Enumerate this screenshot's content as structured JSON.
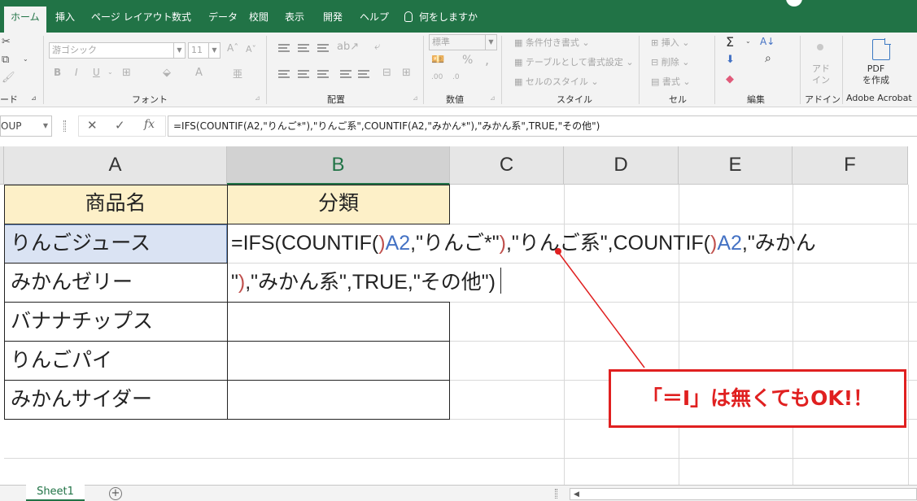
{
  "ribbon_tabs": [
    "ホーム",
    "挿入",
    "ページ レイアウト",
    "数式",
    "データ",
    "校閲",
    "表示",
    "開発",
    "ヘルプ"
  ],
  "tell_me": "何をしますか",
  "ribbon": {
    "clipboard_label": "ード",
    "font_label": "フォント",
    "font_name": "游ゴシック",
    "font_size": "11",
    "alignment_label": "配置",
    "number_label": "数値",
    "number_format": "標準",
    "styles_label": "スタイル",
    "styles_items": [
      "条件付き書式",
      "テーブルとして書式設定",
      "セルのスタイル"
    ],
    "cells_label": "セル",
    "cells_items": [
      "挿入",
      "削除",
      "書式"
    ],
    "editing_label": "編集",
    "addin_label": "アドイン",
    "addin_button": [
      "アド",
      "イン"
    ],
    "adobe_label": "Adobe Acrobat",
    "pdf_button": [
      "PDF",
      "を作成"
    ]
  },
  "formula_bar": {
    "name_box": "OUP",
    "fx": "fx",
    "formula": "=IFS(COUNTIF(A2,\"りんご*\"),\"りんご系\",COUNTIF(A2,\"みかん*\"),\"みかん系\",TRUE,\"その他\")"
  },
  "columns": [
    "A",
    "B",
    "C",
    "D",
    "E",
    "F"
  ],
  "table": {
    "headers": [
      "商品名",
      "分類"
    ],
    "products": [
      "りんごジュース",
      "みかんゼリー",
      "バナナチップス",
      "りんごパイ",
      "みかんサイダー"
    ]
  },
  "edit_lines": {
    "l1_a": "=IFS(COUNTIF(",
    "l1_b": "A2",
    "l1_c": ",\"りんご*\"",
    "l1_d": ")",
    "l1_e": ",\"りんご系\",COUNTIF(",
    "l1_f": "A2",
    "l1_g": ",\"みかん",
    "l2_a": "\"",
    "l2_b": ")",
    "l2_c": ",\"みかん系\",TRUE,\"その他\")"
  },
  "callout": "「＝I」は無くてもOK!！",
  "sheet_tab": "Sheet1",
  "colors": {
    "excel_green": "#217346",
    "callout_red": "#e02020",
    "header_fill": "#fdf0c8",
    "selected_fill": "#dae3f3"
  }
}
